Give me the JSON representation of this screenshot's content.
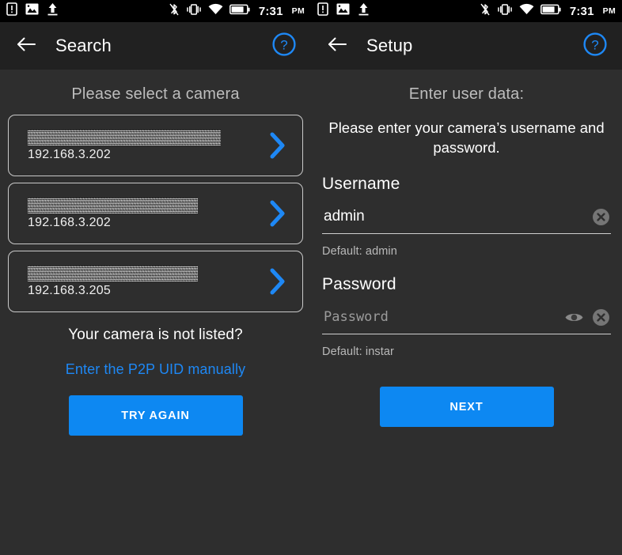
{
  "status_bar": {
    "left_icons": [
      "sim-alert-icon",
      "image-icon",
      "upload-icon"
    ],
    "right_icons": [
      "bluetooth-off-icon",
      "vibrate-icon",
      "wifi-icon",
      "battery-icon"
    ],
    "time": "7:31",
    "meridiem": "PM"
  },
  "left_panel": {
    "appbar": {
      "back_icon": "back-arrow-icon",
      "title": "Search",
      "help_icon": "help-circle-icon"
    },
    "section_header": "Please select a camera",
    "cameras": [
      {
        "name": "",
        "name_redacted": true,
        "redaction_width": 244,
        "ip": "192.168.3.202",
        "chevron": "chevron-right-icon"
      },
      {
        "name": "",
        "name_redacted": true,
        "redaction_width": 215,
        "ip": "192.168.3.202",
        "chevron": "chevron-right-icon"
      },
      {
        "name": "",
        "name_redacted": true,
        "redaction_width": 215,
        "ip": "192.168.3.205",
        "chevron": "chevron-right-icon"
      }
    ],
    "not_listed_text": "Your camera is not listed?",
    "manual_link": "Enter the P2P UID manually",
    "try_again_label": "TRY AGAIN"
  },
  "right_panel": {
    "appbar": {
      "back_icon": "back-arrow-icon",
      "title": "Setup",
      "help_icon": "help-circle-icon"
    },
    "section_header": "Enter user data:",
    "intro": "Please enter your camera’s username and password.",
    "username": {
      "label": "Username",
      "value": "admin",
      "placeholder": "Username",
      "helper": "Default: admin",
      "clear_icon": "clear-circle-icon"
    },
    "password": {
      "label": "Password",
      "value": "",
      "placeholder": "Password",
      "helper": "Default: instar",
      "reveal_icon": "eye-icon",
      "clear_icon": "clear-circle-icon"
    },
    "next_label": "NEXT"
  },
  "colors": {
    "accent_blue": "#0d88f2",
    "link_blue": "#1e88f5",
    "appbar_bg": "#212121",
    "body_bg": "#2e2e2e",
    "statusbar_bg": "#000000",
    "card_border": "#c9c9c9",
    "muted_text": "#bdbdbd"
  }
}
